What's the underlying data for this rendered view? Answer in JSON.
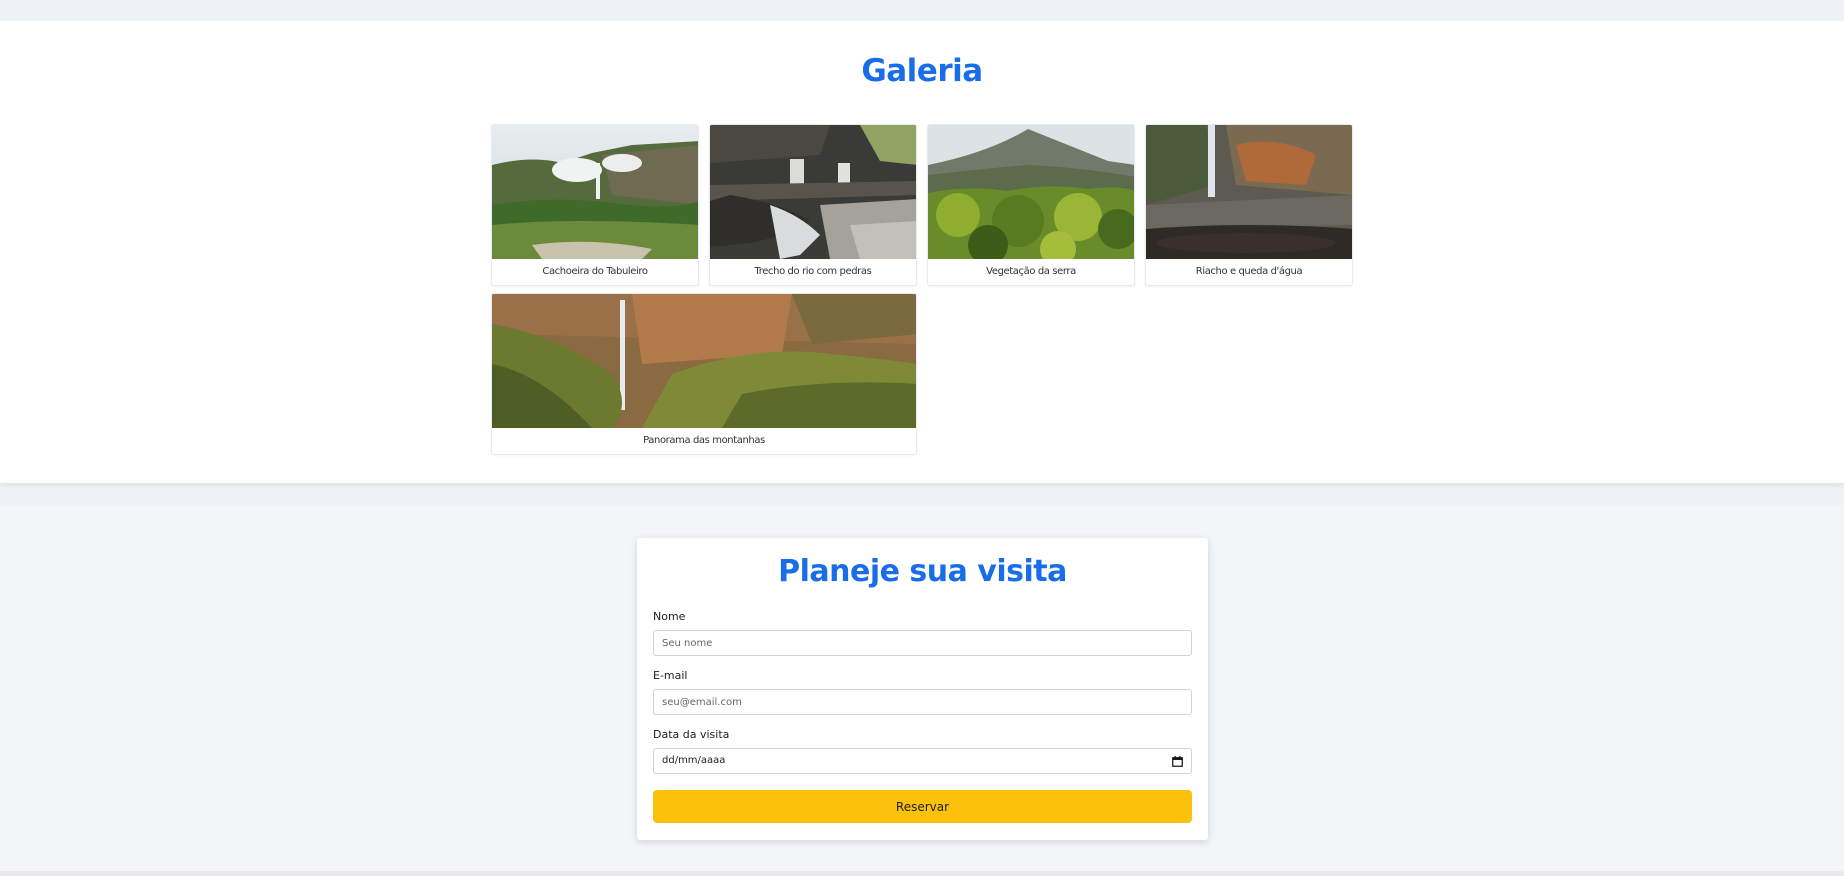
{
  "gallery": {
    "title": "Galeria",
    "items": [
      {
        "caption": "Cachoeira do Tabuleiro",
        "image": "waterfall-cliff-photo"
      },
      {
        "caption": "Trecho do rio com pedras",
        "image": "river-rocks-cascade-photo"
      },
      {
        "caption": "Vegetação da serra",
        "image": "mountain-vegetation-photo"
      },
      {
        "caption": "Riacho e queda d'água",
        "image": "stream-waterfall-pool-photo"
      },
      {
        "caption": "Panorama das montanhas",
        "image": "canyon-waterfall-panorama-photo"
      }
    ]
  },
  "plan": {
    "title": "Planeje sua visita",
    "name": {
      "label": "Nome",
      "placeholder": "Seu nome"
    },
    "email": {
      "label": "E-mail",
      "placeholder": "seu@email.com"
    },
    "date": {
      "label": "Data da visita",
      "value": "dd/mm/aaaa",
      "icon": "calendar-icon"
    },
    "submit_label": "Reservar"
  },
  "colors": {
    "accent": "#1a6de8",
    "button": "#fcc10a",
    "section_bg": "#f3f6f9"
  }
}
